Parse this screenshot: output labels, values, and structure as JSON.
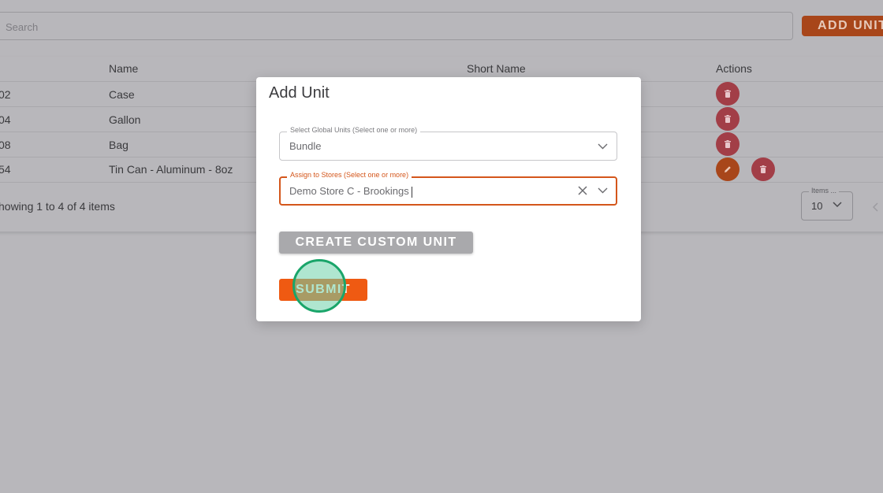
{
  "search": {
    "placeholder": "Search"
  },
  "toolbar": {
    "add_unit_label": "ADD UNIT"
  },
  "table": {
    "headers": {
      "name": "Name",
      "short_name": "Short Name",
      "actions": "Actions"
    },
    "rows": [
      {
        "id": "02",
        "name": "Case"
      },
      {
        "id": "04",
        "name": "Gallon"
      },
      {
        "id": "08",
        "name": "Bag"
      },
      {
        "id": "54",
        "name": "Tin Can - Aluminum - 8oz"
      }
    ],
    "footer_text": "howing 1 to 4 of 4 items",
    "items_per_page_label": "Items ...",
    "items_per_page_value": "10"
  },
  "modal": {
    "title": "Add Unit",
    "global_units": {
      "label": "Select Global Units (Select one or more)",
      "value": "Bundle"
    },
    "assign_stores": {
      "label": "Assign to Stores (Select one or more)",
      "value": "Demo Store C - Brookings"
    },
    "create_custom_label": "CREATE CUSTOM UNIT",
    "submit_label": "SUBMIT"
  },
  "colors": {
    "accent": "#ef5a12",
    "delete": "#a23e47",
    "overlay_bg": "#b8b7bb"
  },
  "icons": [
    "trash-icon",
    "pencil-icon",
    "chevron-down-icon",
    "close-icon",
    "chevron-left-icon"
  ]
}
